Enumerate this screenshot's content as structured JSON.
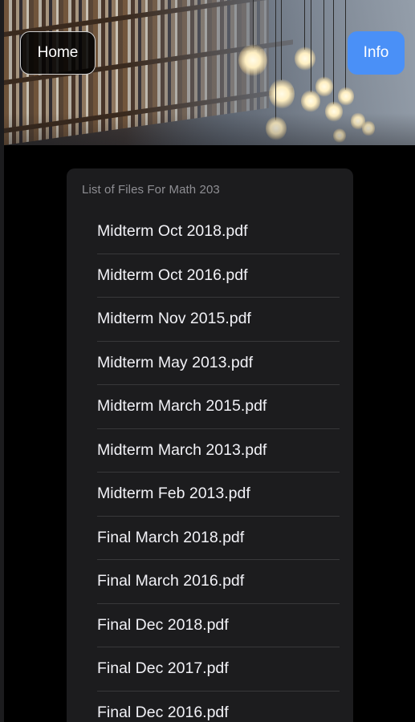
{
  "header": {
    "home_label": "Home",
    "info_label": "Info",
    "info_color": "#4a90f7",
    "image": "library-bookshelf-photo"
  },
  "panel": {
    "title": "List of Files For Math 203",
    "files": [
      "Midterm Oct 2018.pdf",
      "Midterm Oct 2016.pdf",
      "Midterm Nov 2015.pdf",
      "Midterm May 2013.pdf",
      "Midterm March 2015.pdf",
      "Midterm March 2013.pdf",
      "Midterm Feb 2013.pdf",
      "Final March 2018.pdf",
      "Final March 2016.pdf",
      "Final Dec 2018.pdf",
      "Final Dec 2017.pdf",
      "Final Dec 2016.pdf"
    ]
  }
}
